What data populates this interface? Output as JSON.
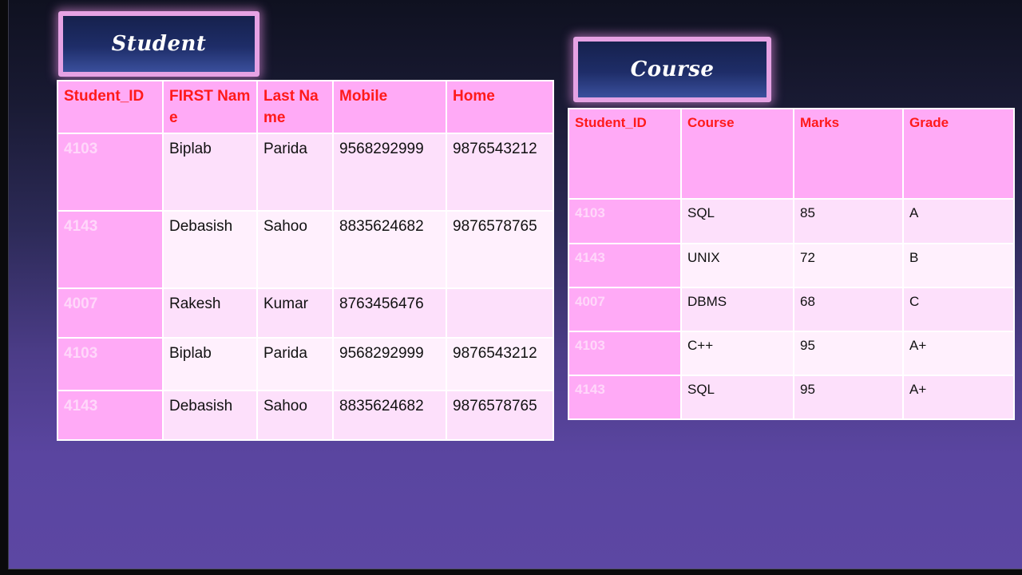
{
  "student": {
    "title": "Student",
    "headers": [
      "Student_ID",
      "FIRST Name",
      "Last Name",
      "Mobile",
      "Home"
    ],
    "rows": [
      [
        "4103",
        "Biplab",
        "Parida",
        "9568292999",
        "9876543212"
      ],
      [
        "4143",
        "Debasish",
        "Sahoo",
        "8835624682",
        "9876578765"
      ],
      [
        "4007",
        "Rakesh",
        "Kumar",
        "8763456476",
        ""
      ],
      [
        "4103",
        "Biplab",
        "Parida",
        "9568292999",
        "9876543212"
      ],
      [
        "4143",
        "Debasish",
        "Sahoo",
        "8835624682",
        "9876578765"
      ]
    ]
  },
  "course": {
    "title": "Course",
    "headers": [
      "Student_ID",
      "Course",
      "Marks",
      "Grade"
    ],
    "rows": [
      [
        "4103",
        "SQL",
        "85",
        "A"
      ],
      [
        "4143",
        "UNIX",
        "72",
        "B"
      ],
      [
        "4007",
        "DBMS",
        "68",
        "C"
      ],
      [
        "4103",
        "C++",
        "95",
        "A+"
      ],
      [
        "4143",
        "SQL",
        "95",
        "A+"
      ]
    ]
  },
  "colors": {
    "header_fill": "#ffaaf6",
    "header_text": "#ff1a1a",
    "id_text": "#ffd7fa",
    "title_border": "#e6a2e4"
  }
}
